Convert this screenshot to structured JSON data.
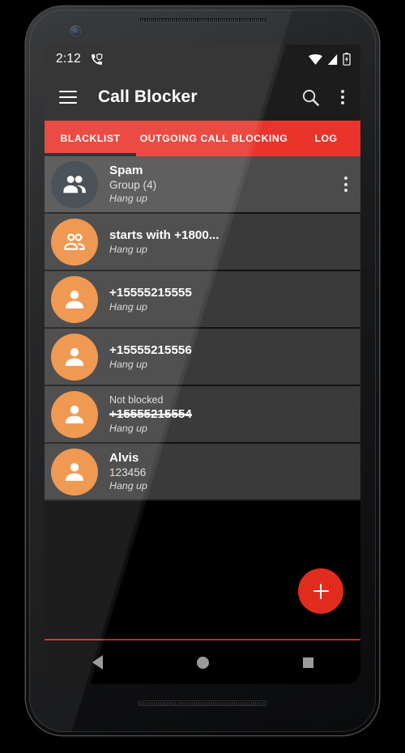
{
  "status_bar": {
    "clock": "2:12",
    "left_icons": [
      "call-shield-icon"
    ],
    "right_icons": [
      "wifi-icon",
      "cellular-signal-icon",
      "battery-charging-icon"
    ]
  },
  "app_bar": {
    "menu_icon": "hamburger-menu-icon",
    "title": "Call Blocker",
    "search_icon": "search-icon",
    "overflow_icon": "overflow-menu-icon"
  },
  "tabs": {
    "active_index": 0,
    "items": [
      {
        "label": "BLACKLIST"
      },
      {
        "label": "OUTGOING CALL BLOCKING"
      },
      {
        "label": "LOG"
      }
    ]
  },
  "list": {
    "rows": [
      {
        "avatar_icon": "group-filled-icon",
        "avatar_style": "slate",
        "pre": "",
        "title": "Spam",
        "sub": "Group (4)",
        "action": "Hang up",
        "selected": true,
        "has_menu": true,
        "struck": false
      },
      {
        "avatar_icon": "group-outline-icon",
        "avatar_style": "orange",
        "pre": "",
        "title": "starts with +1800...",
        "sub": "",
        "action": "Hang up",
        "selected": false,
        "has_menu": false,
        "struck": false
      },
      {
        "avatar_icon": "person-filled-icon",
        "avatar_style": "orange",
        "pre": "",
        "title": "+15555215555",
        "sub": "",
        "action": "Hang up",
        "selected": false,
        "has_menu": false,
        "struck": false
      },
      {
        "avatar_icon": "person-filled-icon",
        "avatar_style": "orange",
        "pre": "",
        "title": "+15555215556",
        "sub": "",
        "action": "Hang up",
        "selected": false,
        "has_menu": false,
        "struck": false
      },
      {
        "avatar_icon": "person-filled-icon",
        "avatar_style": "orange",
        "pre": "Not blocked",
        "title": "+15555215554",
        "sub": "",
        "action": "Hang up",
        "selected": false,
        "has_menu": false,
        "struck": true
      },
      {
        "avatar_icon": "person-filled-icon",
        "avatar_style": "orange",
        "pre": "",
        "title": "Alvis",
        "sub": "123456",
        "action": "Hang up",
        "selected": false,
        "has_menu": false,
        "struck": false
      }
    ]
  },
  "fab": {
    "icon": "plus-icon",
    "label": "+"
  },
  "nav_bar": {
    "back": "back-triangle-icon",
    "home": "home-circle-icon",
    "recents": "recents-square-icon"
  },
  "colors": {
    "accent_red": "#e8342a",
    "fab_red": "#e02b1d",
    "avatar_orange": "#ed8c3d",
    "avatar_slate": "#343d45",
    "row_bg": "#3a3a3a",
    "row_selected_bg": "#4b4b4b",
    "app_bar_bg": "#1c1c1c",
    "screen_bg": "#000000"
  }
}
